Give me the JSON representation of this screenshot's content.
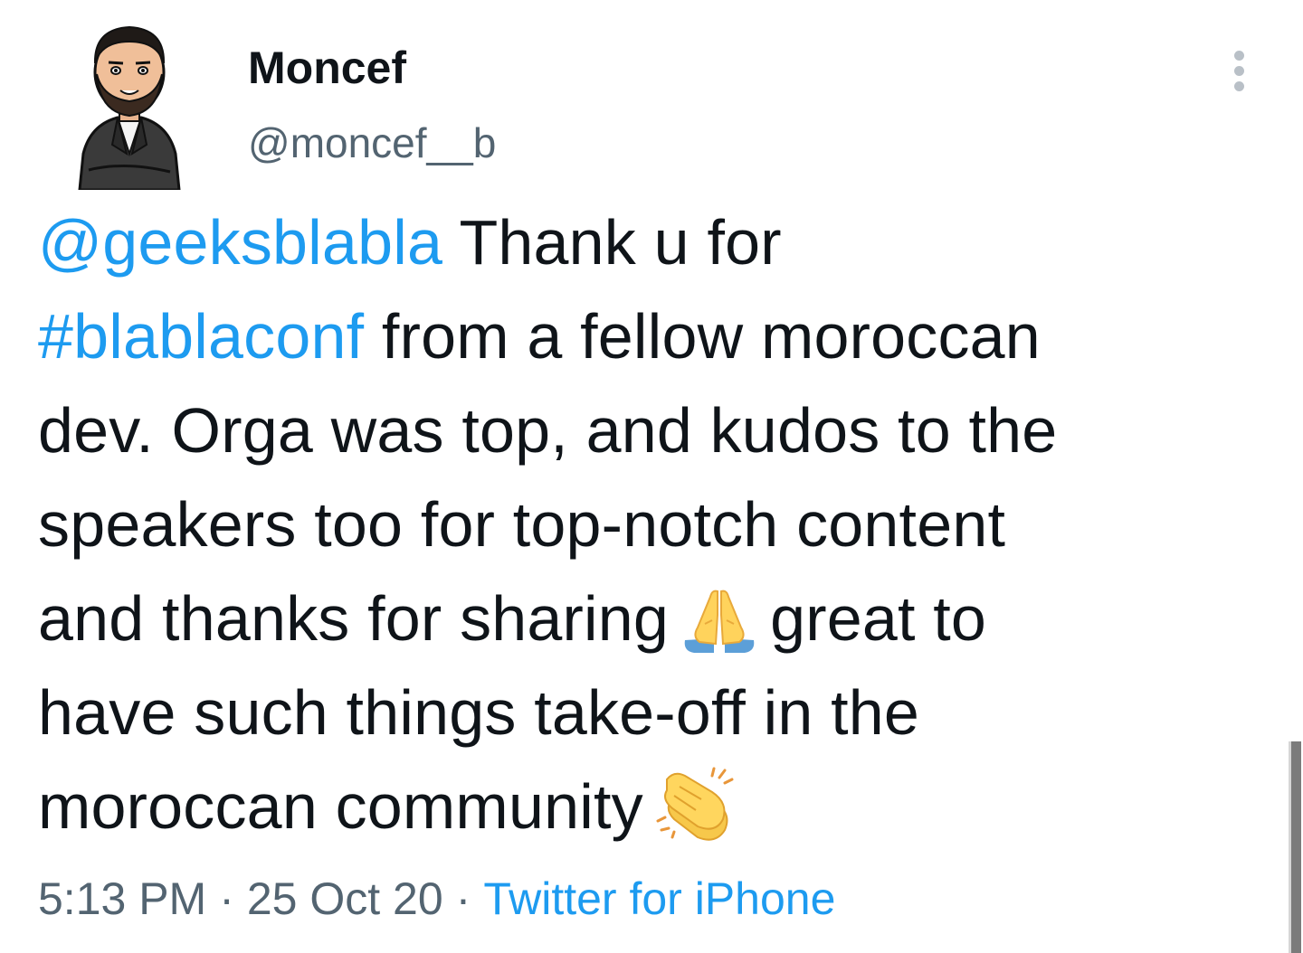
{
  "author": {
    "display_name": "Moncef",
    "handle": "@moncef__b",
    "avatar_icon": "cartoon-avatar-icon"
  },
  "tweet": {
    "lines": [
      [
        {
          "text": "@geeksblabla",
          "type": "mention"
        },
        {
          "text": " Thank u for",
          "type": "text"
        }
      ],
      [
        {
          "text": "#blablaconf",
          "type": "hashtag"
        },
        {
          "text": " from a fellow moroccan",
          "type": "text"
        }
      ],
      [
        {
          "text": "dev. Orga was top, and kudos to the",
          "type": "text"
        }
      ],
      [
        {
          "text": "speakers too for top-notch content",
          "type": "text"
        }
      ],
      [
        {
          "text": "and thanks for sharing",
          "type": "text"
        },
        {
          "emoji": "folded-hands-icon"
        },
        {
          "text": "great to",
          "type": "text"
        }
      ],
      [
        {
          "text": "have such things take-off in the",
          "type": "text"
        }
      ],
      [
        {
          "text": "moroccan community",
          "type": "text"
        },
        {
          "emoji": "clapping-hands-icon"
        }
      ]
    ]
  },
  "meta": {
    "time": "5:13 PM",
    "date": "25 Oct 20",
    "separator": "·",
    "source": "Twitter for iPhone"
  },
  "menu": {
    "icon": "more-vertical-icon"
  },
  "colors": {
    "link": "#1d9bf0",
    "text": "#0f1419",
    "secondary": "#536471",
    "background": "#ffffff"
  }
}
